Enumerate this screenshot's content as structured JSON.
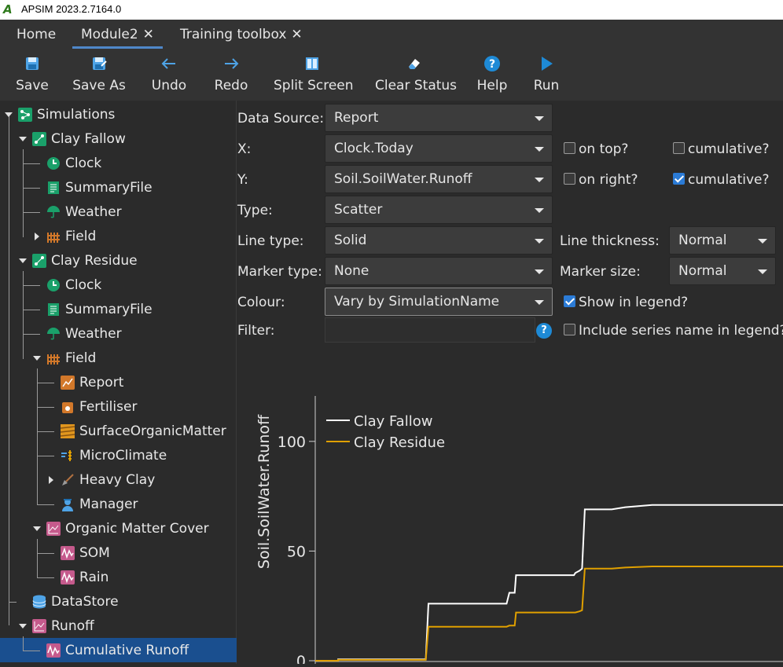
{
  "window": {
    "title": "APSIM 2023.2.7164.0"
  },
  "tabs": [
    {
      "label": "Home",
      "closable": false
    },
    {
      "label": "Module2",
      "closable": true,
      "active": true
    },
    {
      "label": "Training toolbox",
      "closable": true
    }
  ],
  "toolbar": {
    "save": "Save",
    "save_as": "Save As",
    "undo": "Undo",
    "redo": "Redo",
    "split_screen": "Split Screen",
    "clear_status": "Clear Status",
    "help": "Help",
    "run": "Run"
  },
  "tree": {
    "simulations": "Simulations",
    "clay_fallow": "Clay Fallow",
    "cf_clock": "Clock",
    "cf_summary": "SummaryFile",
    "cf_weather": "Weather",
    "cf_field": "Field",
    "clay_residue": "Clay Residue",
    "cr_clock": "Clock",
    "cr_summary": "SummaryFile",
    "cr_weather": "Weather",
    "cr_field": "Field",
    "report": "Report",
    "fertiliser": "Fertiliser",
    "surface_om": "SurfaceOrganicMatter",
    "microclimate": "MicroClimate",
    "heavy_clay": "Heavy Clay",
    "manager": "Manager",
    "om_cover": "Organic Matter Cover",
    "som": "SOM",
    "rain": "Rain",
    "datastore": "DataStore",
    "runoff": "Runoff",
    "cumulative_runoff": "Cumulative Runoff"
  },
  "form": {
    "data_source_label": "Data Source:",
    "data_source_value": "Report",
    "x_label": "X:",
    "x_value": "Clock.Today",
    "x_on_top_label": "on top?",
    "x_on_top": false,
    "x_cumulative_label": "cumulative?",
    "x_cumulative": false,
    "y_label": "Y:",
    "y_value": "Soil.SoilWater.Runoff",
    "y_on_right_label": "on right?",
    "y_on_right": false,
    "y_cumulative_label": "cumulative?",
    "y_cumulative": true,
    "type_label": "Type:",
    "type_value": "Scatter",
    "line_type_label": "Line type:",
    "line_type_value": "Solid",
    "line_thickness_label": "Line thickness:",
    "line_thickness_value": "Normal",
    "marker_type_label": "Marker type:",
    "marker_type_value": "None",
    "marker_size_label": "Marker size:",
    "marker_size_value": "Normal",
    "colour_label": "Colour:",
    "colour_value": "Vary by SimulationName",
    "show_legend_label": "Show in legend?",
    "show_legend": true,
    "filter_label": "Filter:",
    "filter_value": "",
    "include_series_label": "Include series name in legend?",
    "include_series": false
  },
  "chart_data": {
    "type": "line",
    "ylabel": "Soil.SoilWater.Runoff",
    "xlabel": "",
    "ylim": [
      0,
      120
    ],
    "yticks": [
      0,
      50,
      100
    ],
    "grid": false,
    "legend_position": "top-left",
    "series": [
      {
        "name": "Clay Fallow",
        "color": "#ffffff",
        "x": [
          0,
          0.085,
          0.085,
          0.41,
          0.42,
          0.71,
          0.72,
          0.74,
          0.745,
          0.96,
          0.965,
          0.98,
          0.99,
          1.0,
          1.05,
          1.1,
          1.15,
          1.25,
          1.3,
          1.45,
          1.6,
          1.75
        ],
        "y": [
          0,
          0,
          0.6,
          0.6,
          26,
          26,
          31,
          31,
          39,
          39,
          40,
          41,
          42,
          69,
          69,
          69,
          70,
          71,
          71,
          71,
          71,
          71
        ]
      },
      {
        "name": "Clay Residue",
        "color": "#e0a000",
        "x": [
          0,
          0.085,
          0.085,
          0.41,
          0.42,
          0.71,
          0.72,
          0.74,
          0.745,
          0.96,
          0.965,
          0.98,
          0.99,
          1.0,
          1.05,
          1.1,
          1.15,
          1.25,
          1.3,
          1.45,
          1.6,
          1.75
        ],
        "y": [
          0,
          0,
          0.4,
          0.4,
          15.5,
          15.5,
          16,
          16,
          22,
          22,
          22,
          22.5,
          23,
          42,
          42,
          42,
          42.5,
          43,
          43,
          43,
          43,
          43
        ]
      }
    ]
  }
}
